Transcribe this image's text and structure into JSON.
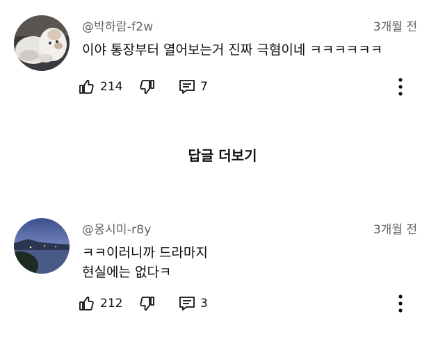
{
  "comments": [
    {
      "author": "@박하람-f2w",
      "time": "3개월 전",
      "text_lines": [
        "이야 통장부터 열어보는거 진짜 극혐이네 ㅋㅋㅋㅋㅋㅋ"
      ],
      "likes": "214",
      "replies": "7",
      "avatar_icon": "cat-photo-avatar"
    },
    {
      "author": "@옹시미-r8y",
      "time": "3개월 전",
      "text_lines": [
        "ㅋㅋ이러니까 드라마지",
        "현실에는 없다ㅋ"
      ],
      "likes": "212",
      "replies": "3",
      "avatar_icon": "coastal-dusk-avatar"
    }
  ],
  "more_replies_label": "답글 더보기",
  "icons": {
    "like": "thumbs-up-icon",
    "dislike": "thumbs-down-icon",
    "reply": "reply-comment-icon",
    "more": "more-vertical-icon"
  },
  "colors": {
    "text": "#0f0f0f",
    "secondary": "#606060"
  }
}
